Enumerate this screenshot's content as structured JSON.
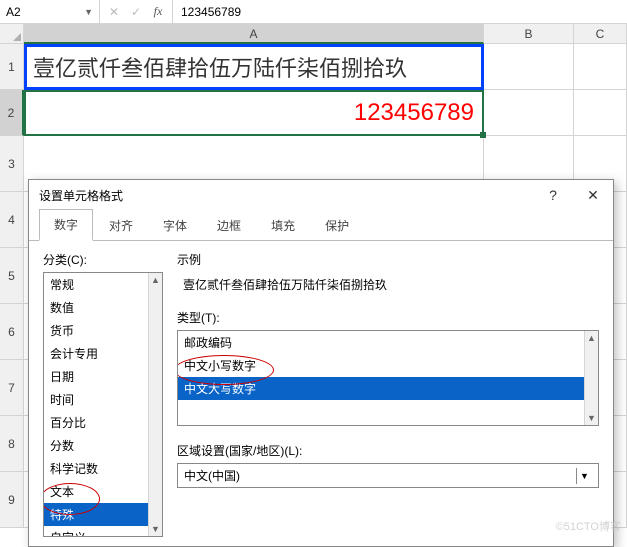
{
  "formula_bar": {
    "name_box": "A2",
    "value": "123456789"
  },
  "columns": [
    "A",
    "B",
    "C"
  ],
  "rows": [
    "1",
    "2",
    "3",
    "4",
    "5",
    "6",
    "7",
    "8",
    "9"
  ],
  "cells": {
    "A1": "壹亿贰仟叁佰肆拾伍万陆仟柒佰捌拾玖",
    "A2": "123456789"
  },
  "dialog": {
    "title": "设置单元格格式",
    "tabs": [
      "数字",
      "对齐",
      "字体",
      "边框",
      "填充",
      "保护"
    ],
    "active_tab": 0,
    "category_label": "分类(C):",
    "categories": [
      "常规",
      "数值",
      "货币",
      "会计专用",
      "日期",
      "时间",
      "百分比",
      "分数",
      "科学记数",
      "文本",
      "特殊",
      "自定义"
    ],
    "category_sel": 10,
    "sample_label": "示例",
    "sample_value": "壹亿贰仟叁佰肆拾伍万陆仟柒佰捌拾玖",
    "type_label": "类型(T):",
    "types": [
      "邮政编码",
      "中文小写数字",
      "中文大写数字"
    ],
    "type_sel": 2,
    "region_label": "区域设置(国家/地区)(L):",
    "region_value": "中文(中国)"
  },
  "watermark": "©51CTO博客"
}
